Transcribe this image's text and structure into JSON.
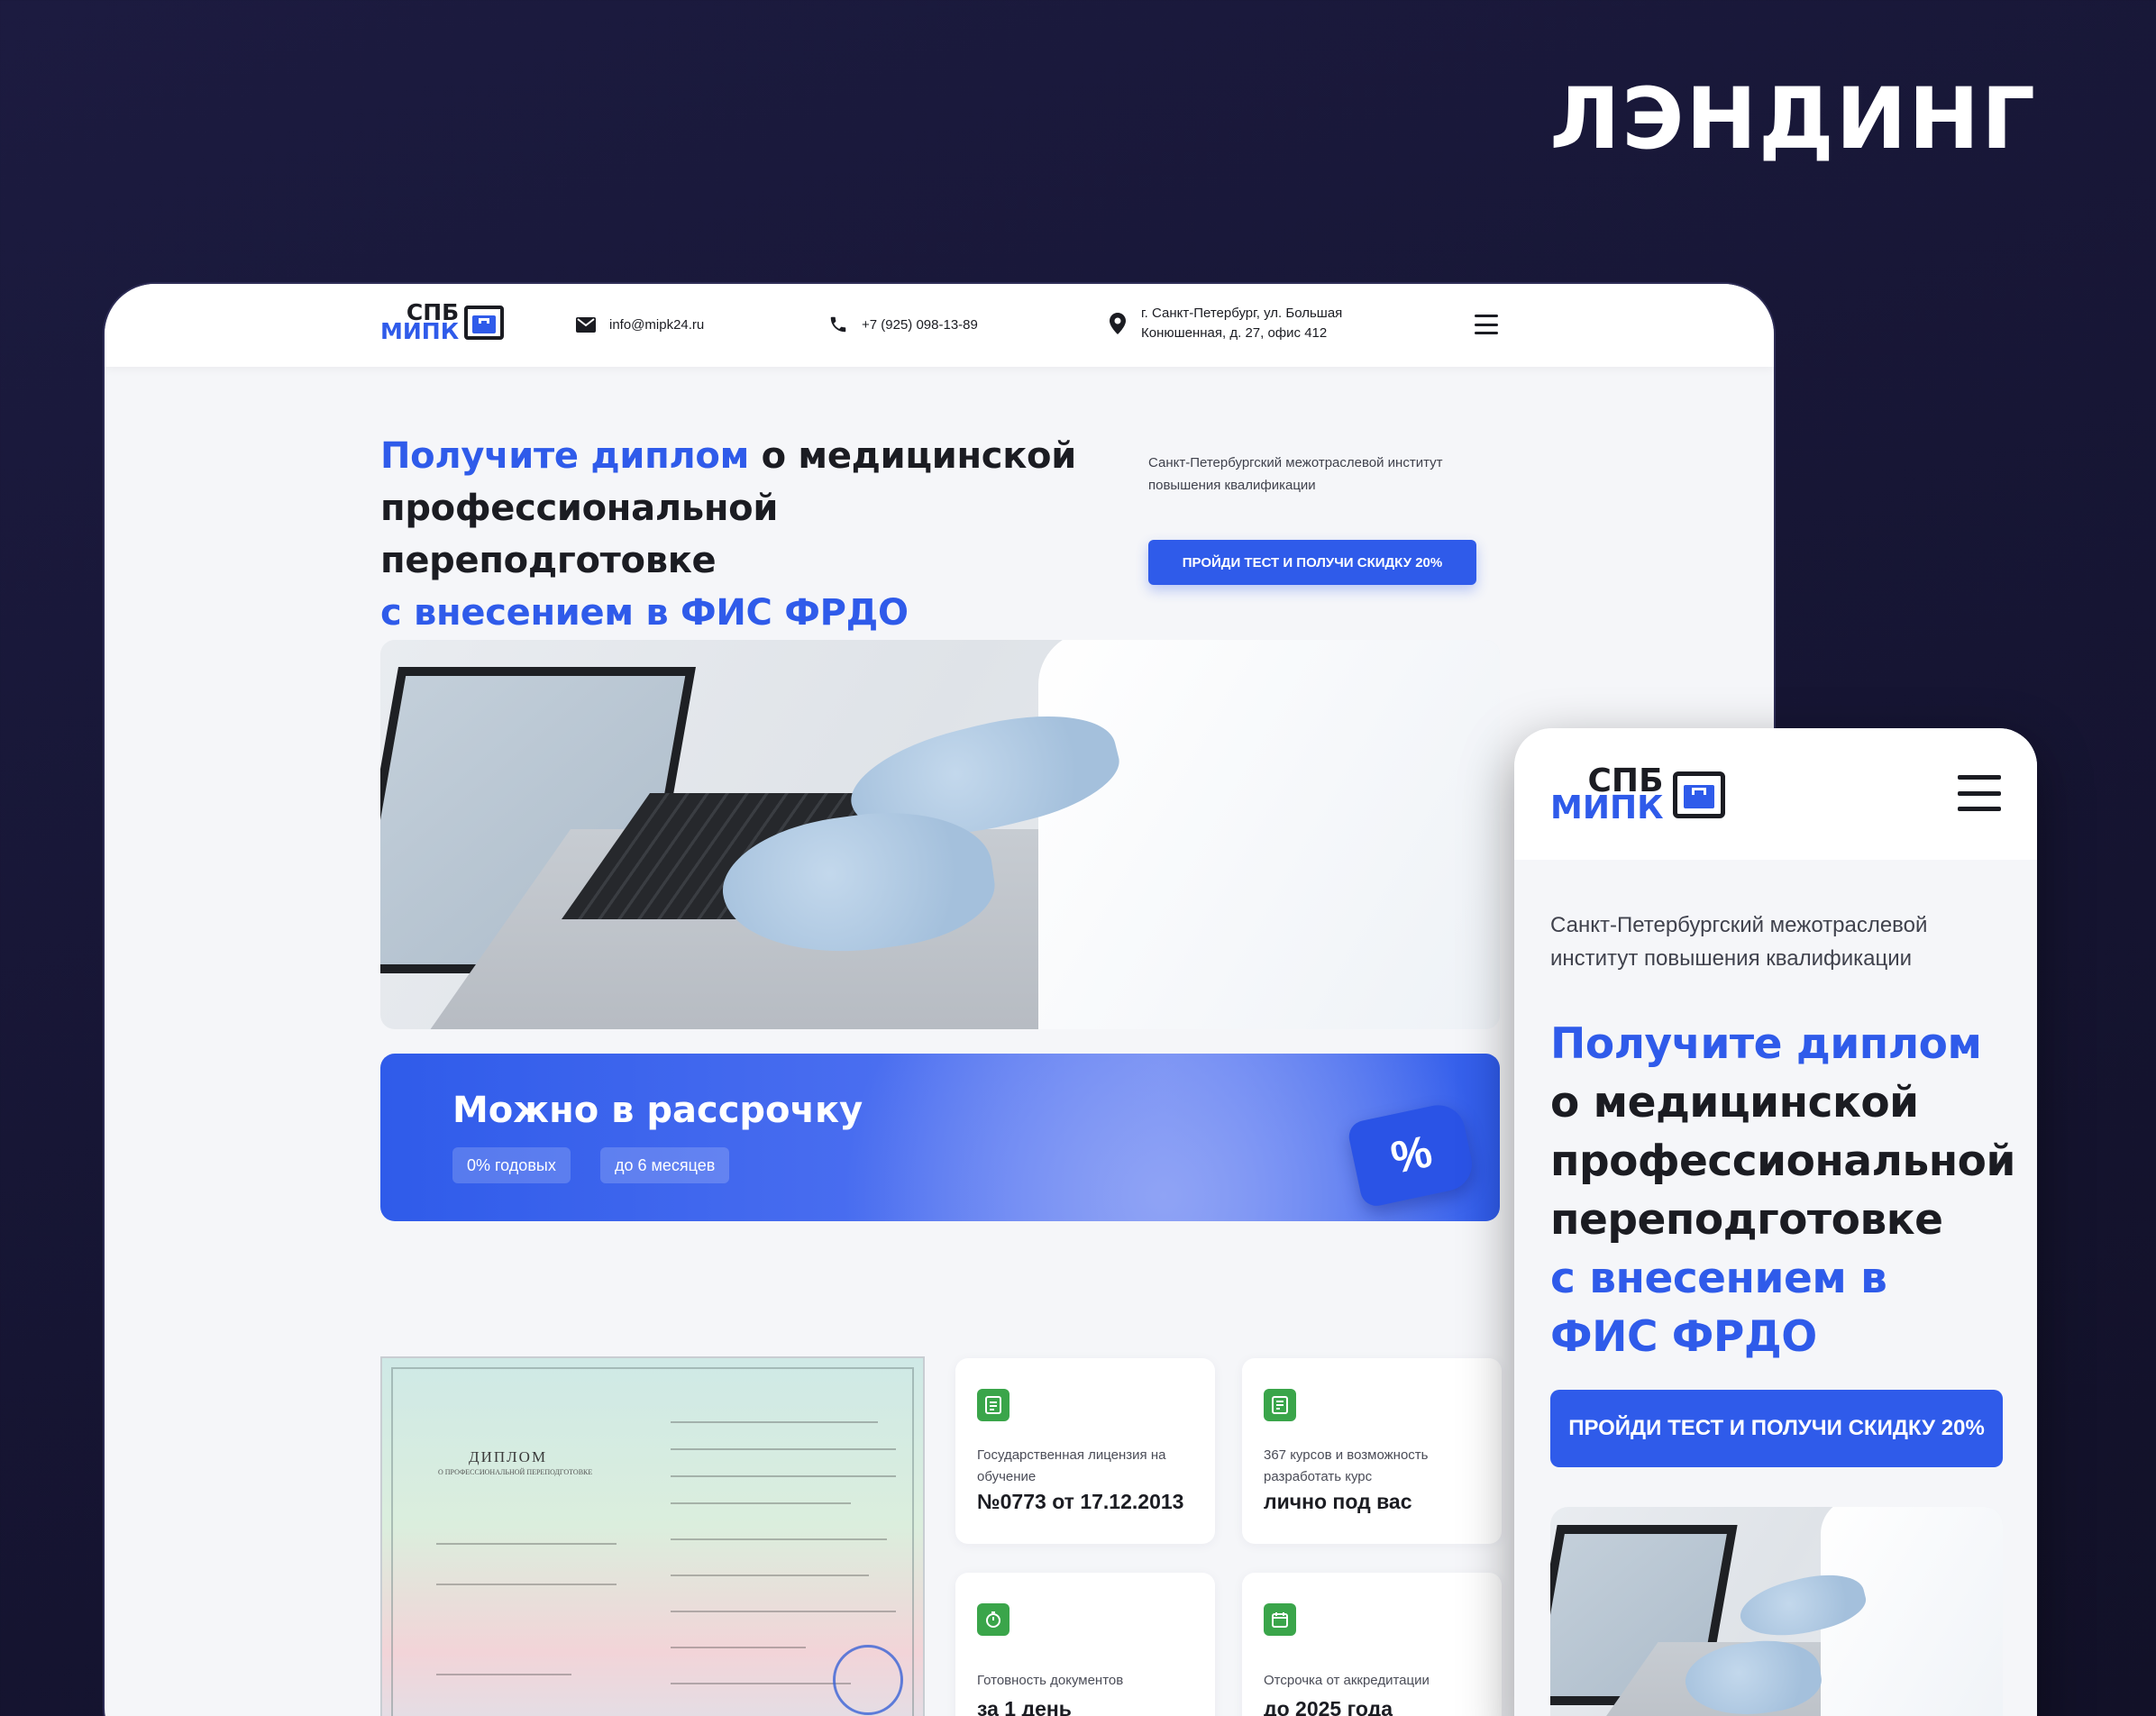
{
  "page_heading": "ЛЭНДИНГ",
  "brand": {
    "line1": "СПБ",
    "line2": "МИПК",
    "accent": "#2f5bea"
  },
  "contacts": {
    "email": "info@mipk24.ru",
    "phone": "+7 (925) 098-13-89",
    "address_line1": "г. Санкт-Петербург, ул. Большая",
    "address_line2": "Конюшенная, д. 27, офис 412"
  },
  "hero": {
    "title_blue_1": "Получите диплом",
    "title_dark": " о медицинской профессиональной переподготовке",
    "title_blue_2": "с внесением в ФИС ФРДО",
    "subtitle": "Санкт-Петербургский межотраслевой институт повышения квалификации",
    "cta": "ПРОЙДИ ТЕСТ И ПОЛУЧИ СКИДКУ 20%"
  },
  "installment": {
    "title": "Можно в рассрочку",
    "pill1": "0% годовых",
    "pill2": "до 6 месяцев",
    "tag_symbol": "%"
  },
  "diploma": {
    "title": "ДИПЛОМ",
    "subtitle": "О ПРОФЕССИОНАЛЬНОЙ ПЕРЕПОДГОТОВКЕ"
  },
  "features": [
    {
      "label": "Государственная лицензия на обучение",
      "value": "№0773 от 17.12.2013",
      "icon": "document-icon"
    },
    {
      "label": "367 курсов и возможность разработать курс",
      "value": "лично под вас",
      "icon": "list-icon"
    },
    {
      "label": "Готовность документов",
      "value": "за 1 день",
      "icon": "timer-icon"
    },
    {
      "label": "Отсрочка от аккредитации",
      "value": "до 2025 года",
      "icon": "calendar-icon"
    }
  ],
  "mobile": {
    "subtitle": "Санкт-Петербургский межотраслевой институт повышения квалификации",
    "cta": "ПРОЙДИ ТЕСТ И ПОЛУЧИ СКИДКУ 20%"
  }
}
